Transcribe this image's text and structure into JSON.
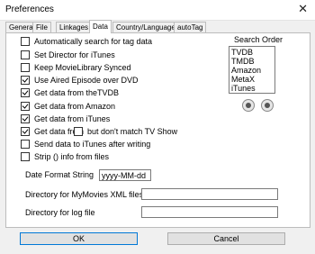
{
  "window": {
    "title": "Preferences",
    "close_glyph": "✕"
  },
  "tabs": [
    "General",
    "File",
    "Linkages",
    "Data",
    "Country/Language",
    "autoTag"
  ],
  "active_tab": "Data",
  "options": [
    {
      "label": "Automatically search for tag data",
      "checked": false
    },
    {
      "label": "Set Director for iTunes",
      "checked": false
    },
    {
      "label": "Keep MovieLibrary Synced",
      "checked": false
    },
    {
      "label": "Use Aired Episode over DVD",
      "checked": true
    },
    {
      "label": "Get data from theTVDB",
      "checked": true
    },
    {
      "label": "Get data from Amazon",
      "checked": true
    },
    {
      "label": "Get data from iTunes",
      "checked": true
    },
    {
      "label": "Get data from",
      "checked": true
    },
    {
      "label": "Send data to iTunes after writing",
      "checked": false
    },
    {
      "label": "Strip () info from files",
      "checked": false
    }
  ],
  "match_tv_show": {
    "label": "but don't match TV Show",
    "checked": false
  },
  "search_order": {
    "label": "Search Order",
    "items": [
      "TVDB",
      "TMDB",
      "Amazon",
      "MetaX",
      "iTunes"
    ]
  },
  "date_format": {
    "label": "Date Format String",
    "value": "yyyy-MM-dd"
  },
  "xml_dir": {
    "label": "Directory for MyMovies XML files",
    "value": ""
  },
  "log_dir": {
    "label": "Directory for log file",
    "value": ""
  },
  "buttons": {
    "ok": "OK",
    "cancel": "Cancel"
  }
}
